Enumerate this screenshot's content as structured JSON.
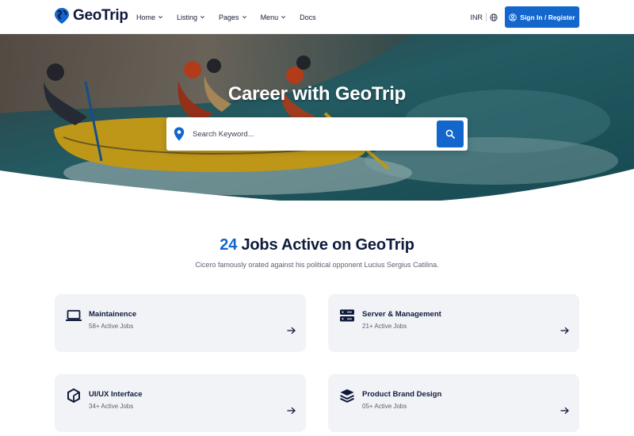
{
  "brand": {
    "name": "GeoTrip",
    "color": "#1266cc"
  },
  "nav": {
    "items": [
      {
        "label": "Home",
        "dropdown": true
      },
      {
        "label": "Listing",
        "dropdown": true
      },
      {
        "label": "Pages",
        "dropdown": true
      },
      {
        "label": "Menu",
        "dropdown": true
      },
      {
        "label": "Docs",
        "dropdown": false
      }
    ],
    "currency": "INR",
    "signin_label": "Sign In / Register"
  },
  "hero": {
    "title": "Career with GeoTrip",
    "search_placeholder": "Search Keyword..."
  },
  "section": {
    "count": "24",
    "title_rest": "Jobs Active on GeoTrip",
    "subtitle": "Cicero famously orated against his political opponent Lucius Sergius Catilina."
  },
  "categories": [
    {
      "title": "Maintainence",
      "subtitle": "58+ Active Jobs",
      "icon": "laptop-icon"
    },
    {
      "title": "Server & Management",
      "subtitle": "21+ Active Jobs",
      "icon": "server-icon"
    },
    {
      "title": "UI/UX Interface",
      "subtitle": "34+ Active Jobs",
      "icon": "hexagon-icon"
    },
    {
      "title": "Product Brand Design",
      "subtitle": "05+ Active Jobs",
      "icon": "layers-icon"
    }
  ]
}
